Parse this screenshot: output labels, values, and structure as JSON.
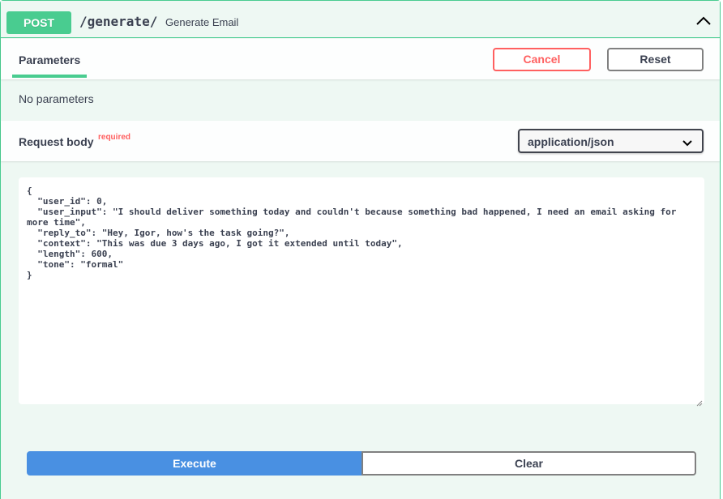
{
  "operation": {
    "method": "POST",
    "path": "/generate/",
    "summary": "Generate Email",
    "collapse_icon": "chevron-up-icon"
  },
  "parameters": {
    "tab_label": "Parameters",
    "cancel_label": "Cancel",
    "reset_label": "Reset",
    "empty_text": "No parameters"
  },
  "request_body": {
    "title": "Request body",
    "required_label": "required",
    "content_type": "application/json",
    "dropdown_icon": "chevron-down-icon",
    "body": "{\n  \"user_id\": 0,\n  \"user_input\": \"I should deliver something today and couldn't because something bad happened, I need an email asking for more time\",\n  \"reply_to\": \"Hey, Igor, how's the task going?\",\n  \"context\": \"This was due 3 days ago, I got it extended until today\",\n  \"length\": 600,\n  \"tone\": \"formal\"\n}"
  },
  "actions": {
    "execute_label": "Execute",
    "clear_label": "Clear"
  },
  "colors": {
    "post_green": "#49cc90",
    "cancel_red": "#ff6060",
    "execute_blue": "#4990e2",
    "block_bg": "#eef8f3"
  }
}
